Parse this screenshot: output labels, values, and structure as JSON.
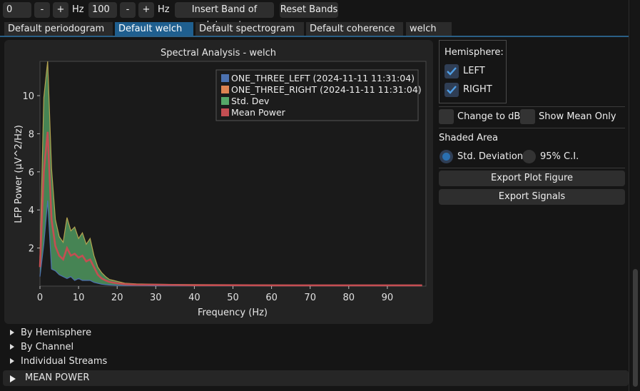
{
  "toolbar": {
    "low_freq_value": "0",
    "decrement_label": "-",
    "increment_label": "+",
    "unit_label": "Hz",
    "high_freq_value": "100",
    "insert_band_label": "Insert Band of Interest",
    "reset_bands_label": "Reset Bands"
  },
  "tabs": [
    {
      "label": "Default periodogram",
      "active": false
    },
    {
      "label": "Default welch",
      "active": true
    },
    {
      "label": "Default spectrogram",
      "active": false
    },
    {
      "label": "Default coherence",
      "active": false
    },
    {
      "label": "welch",
      "active": false
    }
  ],
  "options": {
    "hemisphere_title": "Hemisphere:",
    "left_label": "LEFT",
    "left_checked": true,
    "right_label": "RIGHT",
    "right_checked": true,
    "change_db_label": "Change to dB",
    "change_db_checked": false,
    "show_mean_label": "Show Mean Only",
    "show_mean_checked": false,
    "shaded_area_title": "Shaded Area",
    "std_dev_label": "Std. Deviation",
    "std_dev_selected": true,
    "ci_label": "95% C.I.",
    "ci_selected": false,
    "export_figure_label": "Export Plot Figure",
    "export_signals_label": "Export Signals"
  },
  "tree": {
    "by_hemisphere": "By Hemisphere",
    "by_channel": "By Channel",
    "individual_streams": "Individual Streams",
    "mean_power": "MEAN POWER"
  },
  "colors": {
    "accent": "#1f5f8f",
    "left_series": "#4c72b0",
    "right_series": "#dd8452",
    "std_dev": "#55a868",
    "mean_power": "#c44e52"
  },
  "chart_data": {
    "type": "line",
    "title": "Spectral Analysis - welch",
    "xlabel": "Frequency (Hz)",
    "ylabel": "LFP Power (µV^2/Hz)",
    "xlim": [
      0,
      100
    ],
    "ylim": [
      0,
      11.8
    ],
    "xticks": [
      0,
      10,
      20,
      30,
      40,
      50,
      60,
      70,
      80,
      90
    ],
    "yticks": [
      2,
      4,
      6,
      8,
      10
    ],
    "grid": false,
    "legend_position": "top-right",
    "legend": [
      {
        "label": "ONE_THREE_LEFT (2024-11-11 11:31:04)",
        "color": "#4c72b0"
      },
      {
        "label": "ONE_THREE_RIGHT (2024-11-11 11:31:04)",
        "color": "#dd8452"
      },
      {
        "label": "Std. Dev",
        "color": "#55a868"
      },
      {
        "label": "Mean Power",
        "color": "#c44e52"
      }
    ],
    "x": [
      0,
      1,
      2,
      3,
      4,
      5,
      6,
      7,
      8,
      9,
      10,
      11,
      12,
      13,
      14,
      15,
      16,
      17,
      18,
      19,
      20,
      22,
      25,
      30,
      40,
      50,
      60,
      70,
      80,
      90,
      99
    ],
    "upper": [
      1.5,
      9.9,
      11.8,
      6.2,
      3.5,
      2.6,
      2.3,
      3.6,
      2.9,
      3.1,
      2.5,
      2.8,
      2.2,
      2.5,
      1.6,
      1.0,
      0.7,
      0.5,
      0.35,
      0.3,
      0.25,
      0.15,
      0.12,
      0.1,
      0.08,
      0.07,
      0.06,
      0.05,
      0.05,
      0.05,
      0.05
    ],
    "mean": [
      1.0,
      6.0,
      8.1,
      3.5,
      2.1,
      1.6,
      1.4,
      2.0,
      1.6,
      1.7,
      1.5,
      1.6,
      1.3,
      1.4,
      1.0,
      0.6,
      0.4,
      0.3,
      0.22,
      0.18,
      0.15,
      0.1,
      0.08,
      0.07,
      0.05,
      0.05,
      0.04,
      0.04,
      0.04,
      0.04,
      0.04
    ],
    "lower": [
      0.5,
      2.2,
      4.5,
      0.9,
      0.8,
      0.6,
      0.5,
      0.4,
      0.5,
      0.3,
      0.4,
      0.3,
      0.3,
      0.3,
      0.2,
      0.15,
      0.1,
      0.08,
      0.06,
      0.05,
      0.04,
      0.03,
      0.03,
      0.02,
      0.02,
      0.02,
      0.02,
      0.02,
      0.02,
      0.02,
      0.02
    ]
  }
}
